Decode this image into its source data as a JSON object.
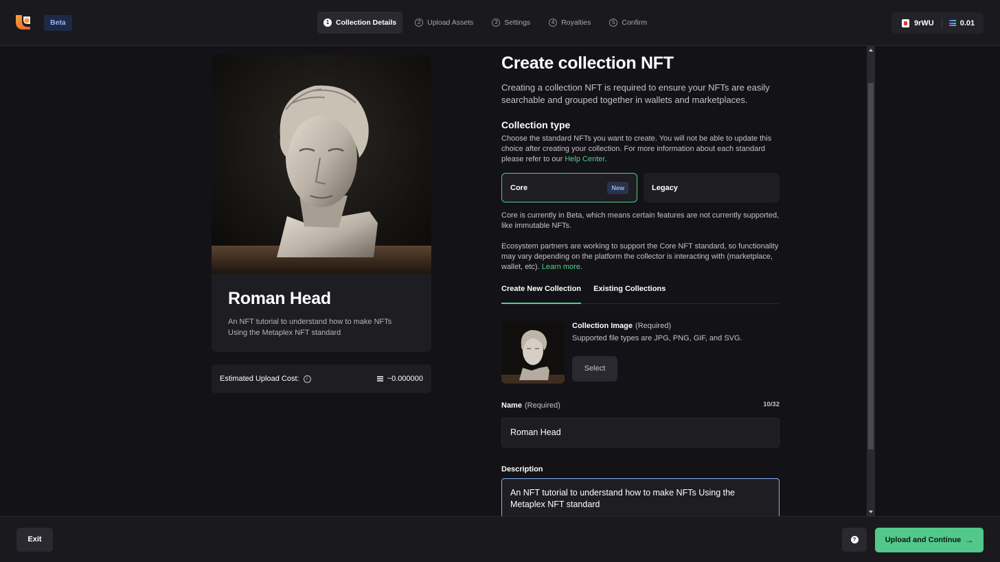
{
  "header": {
    "beta_label": "Beta",
    "steps": [
      {
        "num": "1",
        "label": "Collection Details",
        "active": true
      },
      {
        "num": "2",
        "label": "Upload Assets",
        "active": false
      },
      {
        "num": "3",
        "label": "Settings",
        "active": false
      },
      {
        "num": "4",
        "label": "Royalties",
        "active": false
      },
      {
        "num": "5",
        "label": "Confirm",
        "active": false
      }
    ],
    "wallet": {
      "address_short": "9rWU",
      "sol_balance": "0.01"
    }
  },
  "preview": {
    "title": "Roman Head",
    "description": "An NFT tutorial to understand how to make NFTs Using the Metaplex NFT standard",
    "cost_label": "Estimated Upload Cost:",
    "cost_value": "~0.000000"
  },
  "form": {
    "title": "Create collection NFT",
    "intro": "Creating a collection NFT is required to ensure your NFTs are easily searchable and grouped together in wallets and marketplaces.",
    "collection_type_title": "Collection type",
    "collection_type_desc": "Choose the standard NFTs you want to create. You will not be able to update this choice after creating your collection. For more information about each standard please refer to our",
    "help_center_link": "Help Center",
    "types": [
      {
        "label": "Core",
        "badge": "New",
        "selected": true
      },
      {
        "label": "Legacy",
        "badge": "",
        "selected": false
      }
    ],
    "core_note": "Core is currently in Beta, which means certain features are not currently supported, like immutable NFTs.",
    "ecosystem_note": "Ecosystem partners are working to support the Core NFT standard, so functionality may vary depending on the platform the collector is interacting with (marketplace, wallet, etc).",
    "learn_more_link": "Learn more",
    "tabs": [
      "Create New Collection",
      "Existing Collections"
    ],
    "collection_image": {
      "label": "Collection Image",
      "required": "(Required)",
      "help": "Supported file types are JPG, PNG, GIF, and SVG.",
      "select_label": "Select"
    },
    "name": {
      "label": "Name",
      "required": "(Required)",
      "counter": "10/32",
      "value": "Roman Head"
    },
    "description": {
      "label": "Description",
      "value": "An NFT tutorial to understand how to make NFTs Using the Metaplex NFT standard"
    }
  },
  "footer": {
    "exit_label": "Exit",
    "help_label": "?",
    "upload_label": "Upload and Continue"
  },
  "colors": {
    "accent": "#4fd18b",
    "background": "#131216",
    "panel": "#1e1d22"
  }
}
